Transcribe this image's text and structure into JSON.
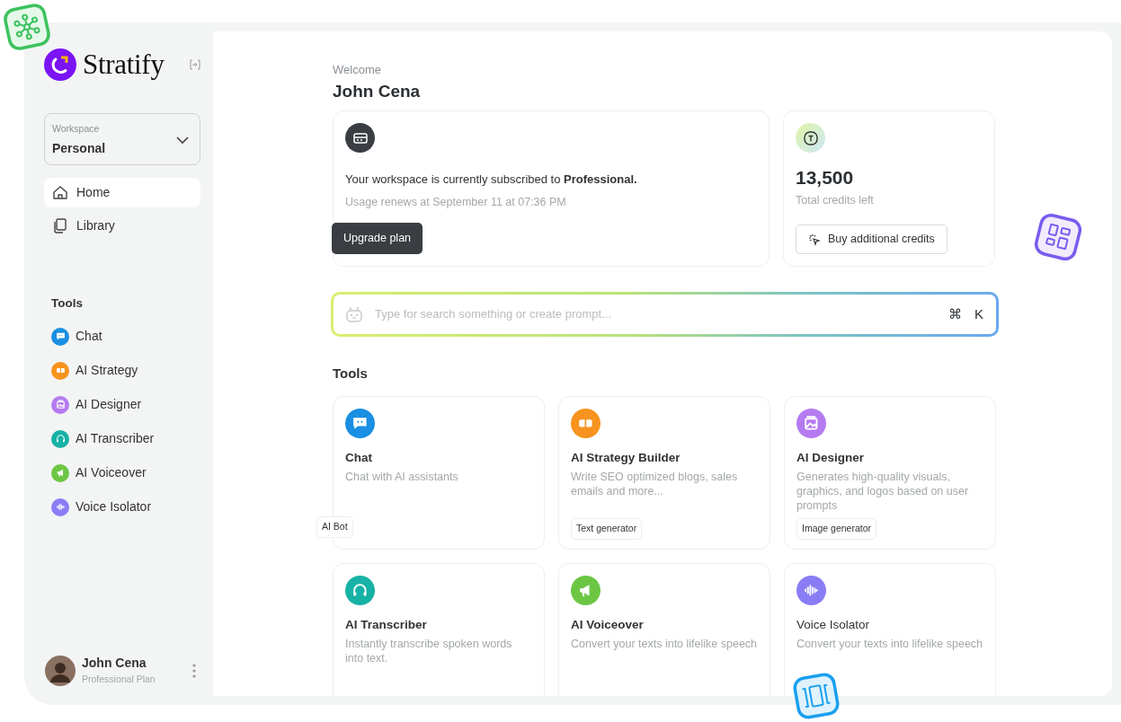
{
  "brand": "Stratify",
  "workspace": {
    "label": "Workspace",
    "value": "Personal"
  },
  "nav": [
    {
      "label": "Home",
      "kind": "home",
      "selected": true
    },
    {
      "label": "Library",
      "kind": "library",
      "selected": false
    }
  ],
  "tools_heading": "Tools",
  "tools_nav": [
    {
      "label": "Chat",
      "kind": "chat",
      "color": "#1a8fe3"
    },
    {
      "label": "AI Strategy",
      "kind": "strategy",
      "color": "#f7931e"
    },
    {
      "label": "AI Designer",
      "kind": "designer",
      "color": "#b57bf0"
    },
    {
      "label": "AI Transcriber",
      "kind": "transcriber",
      "color": "#17b2a6"
    },
    {
      "label": "AI Voiceover",
      "kind": "voiceover",
      "color": "#6cc644"
    },
    {
      "label": "Voice Isolator",
      "kind": "isolator",
      "color": "#8a7cf5"
    }
  ],
  "user": {
    "name": "John Cena",
    "plan": "Professional Plan"
  },
  "welcome": {
    "greeting": "Welcome",
    "name": "John Cena"
  },
  "subscription": {
    "text": "Your workspace is currently subscribed to **Professional.**",
    "renewal": "Usage renews at September 11 at 07:36 PM",
    "button": "Upgrade plan"
  },
  "credits": {
    "amount": "13,500",
    "label": "Total credits left",
    "button": "Buy additional credits"
  },
  "search": {
    "placeholder": "Type for search something or create prompt...",
    "shortcut": [
      "⌘",
      "K"
    ]
  },
  "tools_title": "Tools",
  "tools": [
    {
      "title": "Chat",
      "description": "Chat with AI assistants",
      "tag": "AI Bot",
      "kind": "chat",
      "color": "#1a8fe3"
    },
    {
      "title": "AI Strategy Builder",
      "description": "Write SEO optimized blogs, sales emails and more...",
      "tag": "Text generator",
      "kind": "strategy",
      "color": "#f7931e"
    },
    {
      "title": "AI Designer",
      "description": "Generates high-quality visuals, graphics, and logos based on user prompts",
      "tag": "Image generator",
      "kind": "designer",
      "color": "#b57bf0"
    },
    {
      "title": "AI Transcriber",
      "description": "Instantly transcribe spoken words into text.",
      "kind": "transcriber",
      "color": "#17b2a6"
    },
    {
      "title": "AI Voiceover",
      "description": "Convert your texts into lifelike speech",
      "kind": "voiceover",
      "color": "#6cc644"
    },
    {
      "title": "Voice Isolator",
      "description": "Convert your texts into lifelike speech",
      "kind": "isolator",
      "color": "#8a7cf5"
    }
  ]
}
